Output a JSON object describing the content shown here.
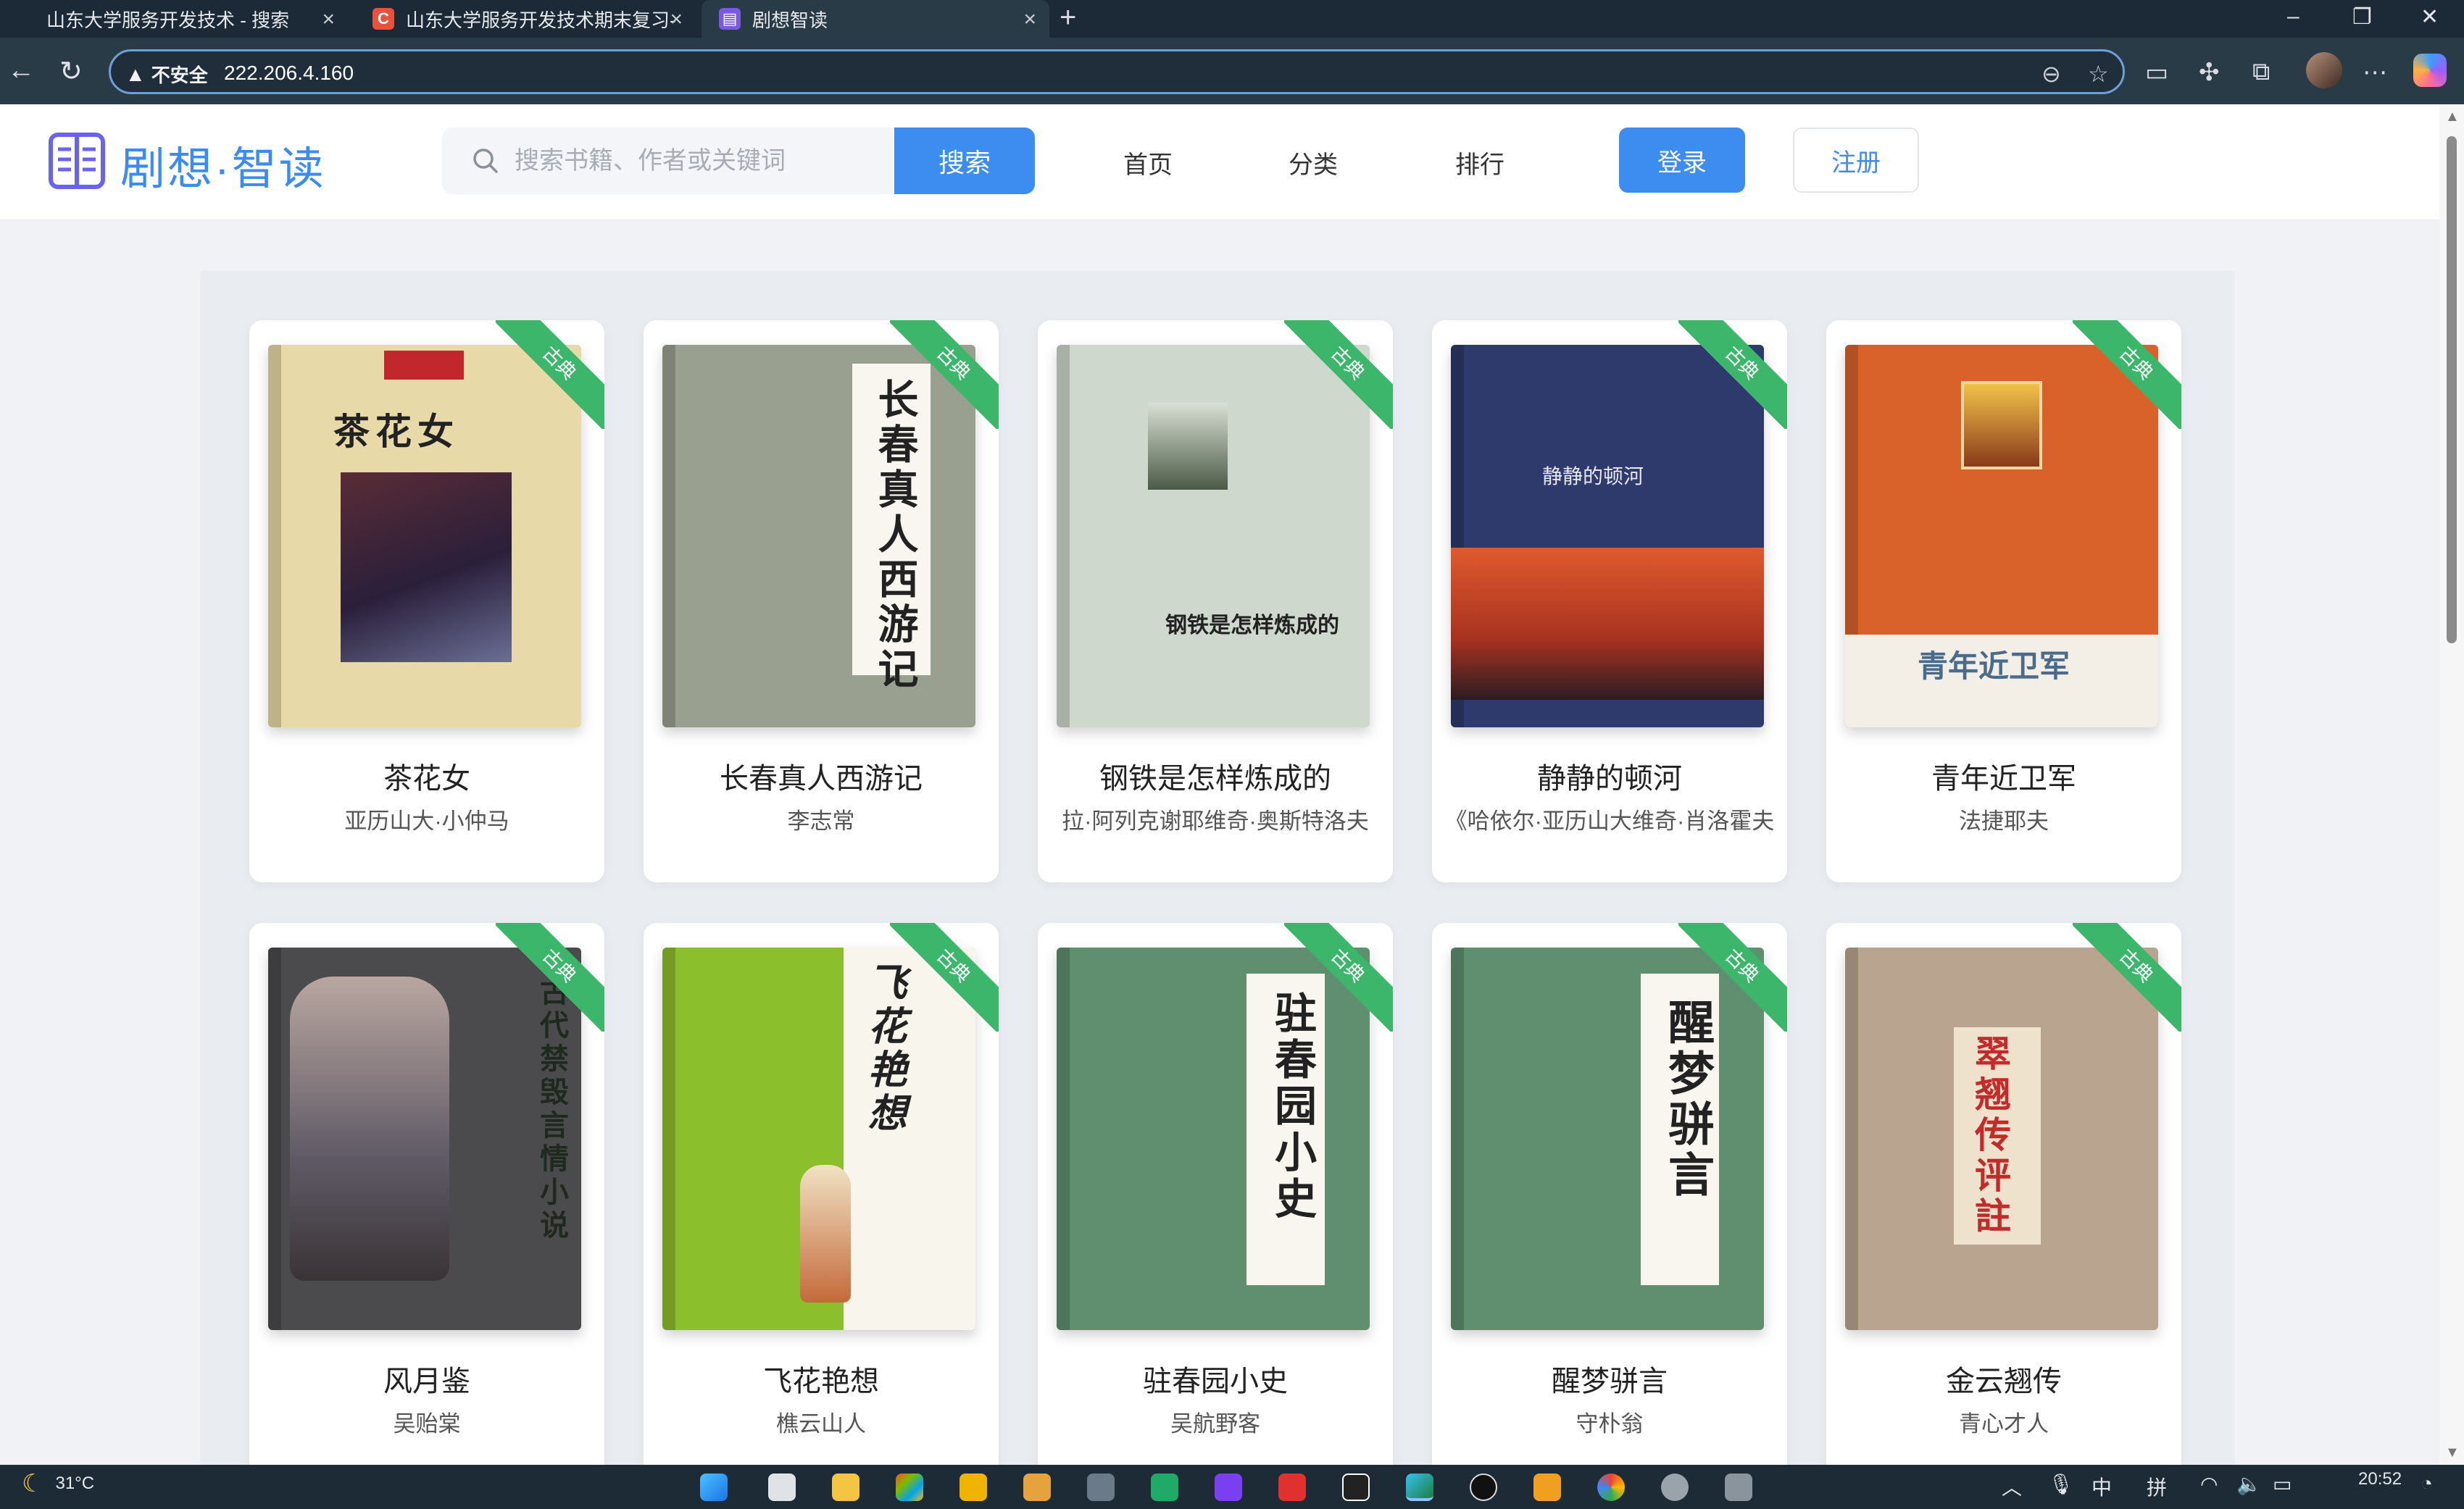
{
  "browser": {
    "tabs": [
      {
        "title": "山东大学服务开发技术 - 搜索"
      },
      {
        "title": "山东大学服务开发技术期末复习-"
      },
      {
        "title": "剧想智读"
      }
    ],
    "address": {
      "security_label": "不安全",
      "url": "222.206.4.160"
    }
  },
  "site": {
    "logo_text": "剧想·智读",
    "search": {
      "placeholder": "搜索书籍、作者或关键词",
      "button_label": "搜索"
    },
    "nav": [
      {
        "label": "首页"
      },
      {
        "label": "分类"
      },
      {
        "label": "排行"
      }
    ],
    "login_label": "登录",
    "register_label": "注册",
    "colors": {
      "accent": "#3d8cf0",
      "ribbon": "#3bb66b"
    }
  },
  "books": [
    {
      "title": "茶花女",
      "author": "亚历山大·小仲马",
      "tag": "古典",
      "cover_text": "茶花女",
      "cover_color": "#e8d9a8"
    },
    {
      "title": "长春真人西游记",
      "author": "李志常",
      "tag": "古典",
      "cover_text": "长春真人西游记",
      "cover_color": "#9aa090"
    },
    {
      "title": "钢铁是怎样炼成的",
      "author": "拉·阿列克谢耶维奇·奥斯特洛夫",
      "tag": "古典",
      "cover_text": "钢铁是怎样炼成的",
      "cover_color": "#cfd8cc"
    },
    {
      "title": "静静的顿河",
      "author": "《哈依尔·亚历山大维奇·肖洛霍夫",
      "tag": "古典",
      "cover_text": "静静的顿河",
      "cover_color": "#2d3a6b"
    },
    {
      "title": "青年近卫军",
      "author": "法捷耶夫",
      "tag": "古典",
      "cover_text": "青年近卫军",
      "cover_color": "#d9622a"
    },
    {
      "title": "风月鉴",
      "author": "吴贻棠",
      "tag": "古典",
      "cover_text": "古代禁毁言情小说",
      "cover_color": "#4b4a4c"
    },
    {
      "title": "飞花艳想",
      "author": "樵云山人",
      "tag": "古典",
      "cover_text": "飞花艳想",
      "cover_color": "#8cbf2c"
    },
    {
      "title": "驻春园小史",
      "author": "吴航野客",
      "tag": "古典",
      "cover_text": "驻春园小史",
      "cover_color": "#5f8f6e"
    },
    {
      "title": "醒梦骈言",
      "author": "守朴翁",
      "tag": "古典",
      "cover_text": "醒梦骈言",
      "cover_color": "#5f8f6e"
    },
    {
      "title": "金云翘传",
      "author": "青心才人",
      "tag": "古典",
      "cover_text": "翠翘传评註",
      "cover_color": "#b9a58f"
    }
  ],
  "taskbar": {
    "weather": "31°C",
    "time": "20:52",
    "ime_1": "中",
    "ime_2": "拼"
  }
}
